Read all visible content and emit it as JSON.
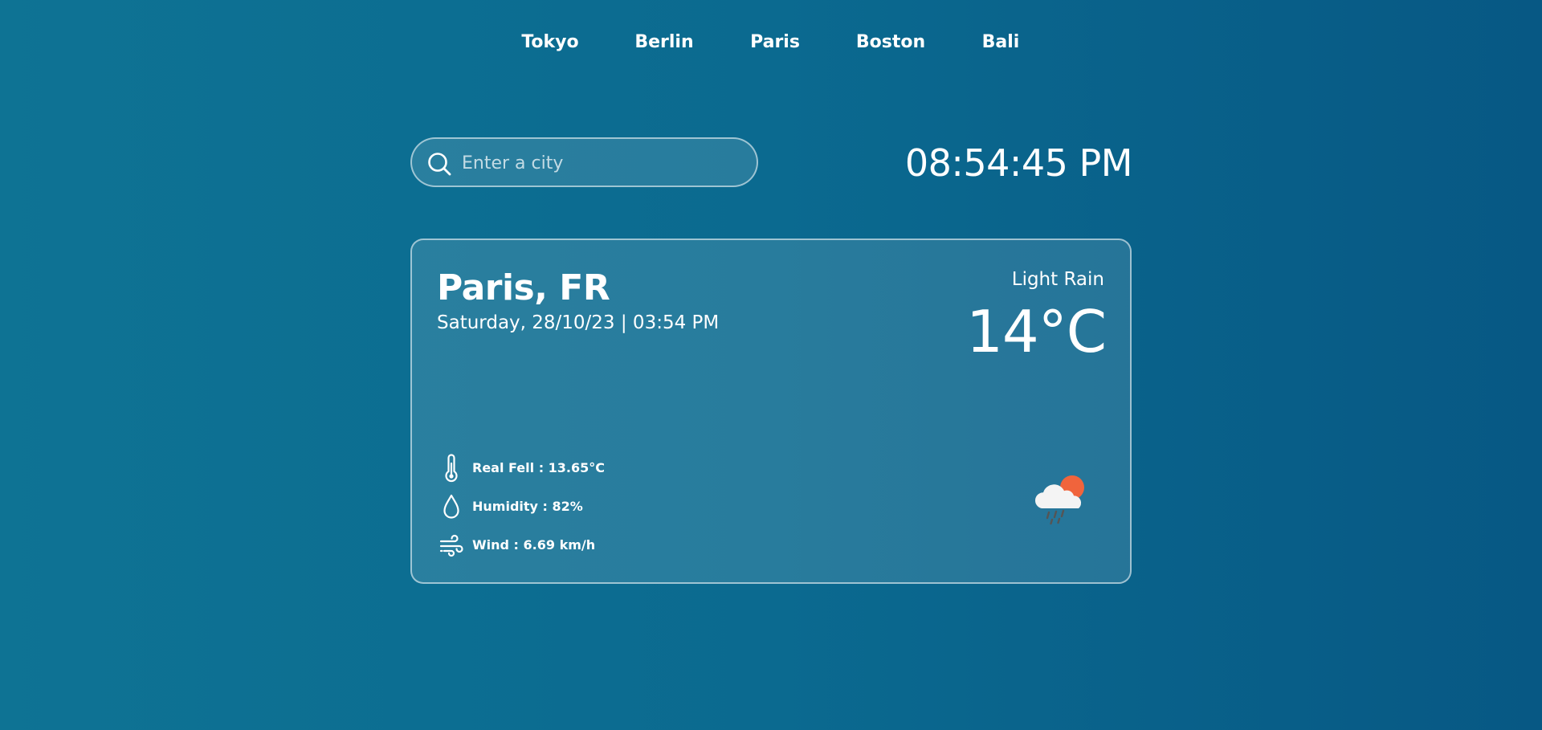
{
  "nav": {
    "cities": [
      {
        "label": "Tokyo"
      },
      {
        "label": "Berlin"
      },
      {
        "label": "Paris"
      },
      {
        "label": "Boston"
      },
      {
        "label": "Bali"
      }
    ]
  },
  "search": {
    "placeholder": "Enter a city",
    "value": "",
    "icon": "search-icon"
  },
  "clock": {
    "time": "08:54:45 PM"
  },
  "weather": {
    "location": "Paris, FR",
    "datetime": "Saturday, 28/10/23 | 03:54 PM",
    "condition": "Light Rain",
    "temperature": "14°C",
    "icon": "cloud-sun-rain-icon",
    "details": {
      "real_feel": "Real Fell : 13.65°C",
      "humidity": "Humidity : 82%",
      "wind": "Wind : 6.69 km/h"
    }
  },
  "colors": {
    "background_start": "#0e7394",
    "background_end": "#075884",
    "sun": "#f0643c",
    "cloud": "#f4f4f4",
    "rain": "#555555"
  }
}
